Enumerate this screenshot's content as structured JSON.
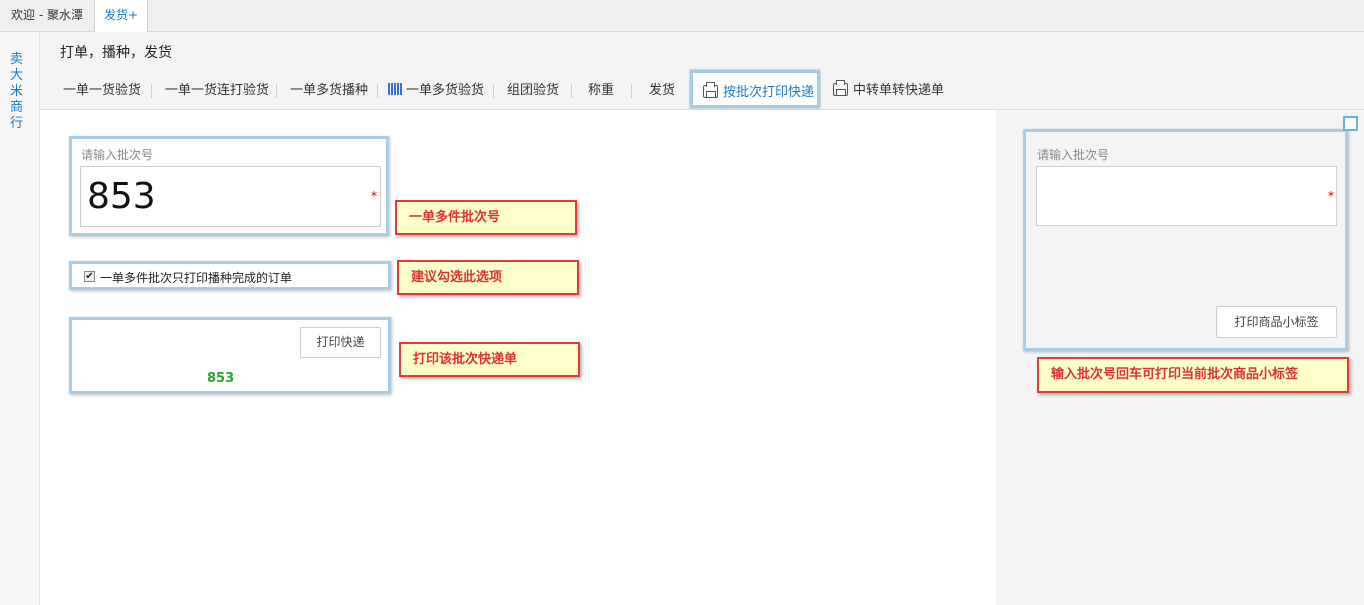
{
  "tabs": {
    "welcome": "欢迎 - 聚水潭",
    "ship": "发货+"
  },
  "sidebar": {
    "shop_name": "卖大米商行"
  },
  "page": {
    "title": "打单，播种，发货"
  },
  "subnav": {
    "items": [
      "一单一货验货",
      "一单一货连打验货",
      "一单多货播种",
      "一单多货验货",
      "组团验货",
      "称重",
      "发货",
      "按批次打印快递",
      "中转单转快递单"
    ],
    "active_index": 7
  },
  "batch_form": {
    "label": "请输入批次号",
    "value": "853",
    "required_mark": "*",
    "checkbox_label": "一单多件批次只打印播种完成的订单",
    "checkbox_checked": true,
    "checkbox_glyph": "✔",
    "print_button": "打印快递",
    "batch_display": "853"
  },
  "label_form": {
    "label": "请输入批次号",
    "value": "",
    "required_mark": "*",
    "print_button": "打印商品小标签"
  },
  "callouts": {
    "batch_no": "一单多件批次号",
    "suggest": "建议勾选此选项",
    "print_express": "打印该批次快递单",
    "label_tip": "输入批次号回车可打印当前批次商品小标签"
  },
  "colors": {
    "accent": "#1a7ac6",
    "callout_text": "#e0332e",
    "callout_bg": "#ffffcc",
    "highlight_border": "#a9cde6",
    "batch_number_green": "#2aa52a"
  },
  "icons": {
    "grid": "barcode-grid-icon",
    "printer": "printer-icon"
  }
}
